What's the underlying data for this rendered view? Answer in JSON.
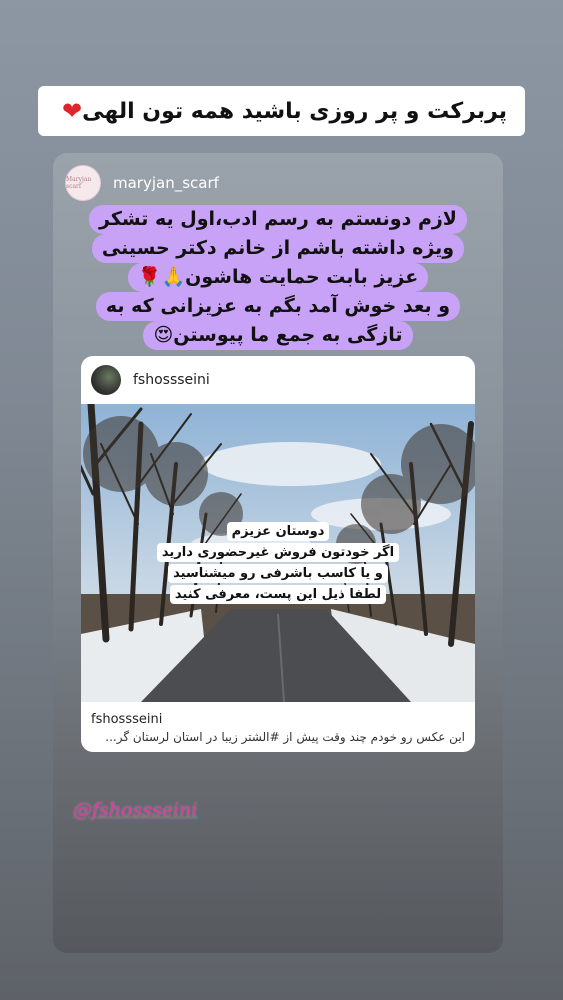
{
  "banner": {
    "text": "پربرکت و پر روزی باشید همه تون الهی",
    "emoji": "❤"
  },
  "post": {
    "username": "maryjan_scarf",
    "avatar_text": "Maryjan scarf",
    "caption_lines": [
      "لازم دونستم به رسم ادب،اول یه تشکر",
      "ویژه داشته باشم از خانم دکتر حسینی",
      "عزیز بابت حمایت هاشون🙏🌹",
      "و بعد خوش آمد بگم به عزیزانی که به",
      "تازگی به جمع ما پیوستن😍"
    ]
  },
  "embed": {
    "username": "fshossseini",
    "photo_text_lines": [
      "دوستان عزیزم",
      "اگر خودتون فروش غیرحضوری دارید",
      "و یا کاسب باشرفی رو میشناسید",
      "لطفا ذیل این پست، معرفی کنید"
    ],
    "footer_username": "fshossseini",
    "footer_caption": "این عکس رو خودم چند وقت پیش از #الشتر زیبا در استان لرستان گر..."
  },
  "mention": "@fshossseini",
  "colors": {
    "caption_bg": "#c8a2f6",
    "mention": "#d93da0",
    "heart": "#e0242e"
  }
}
